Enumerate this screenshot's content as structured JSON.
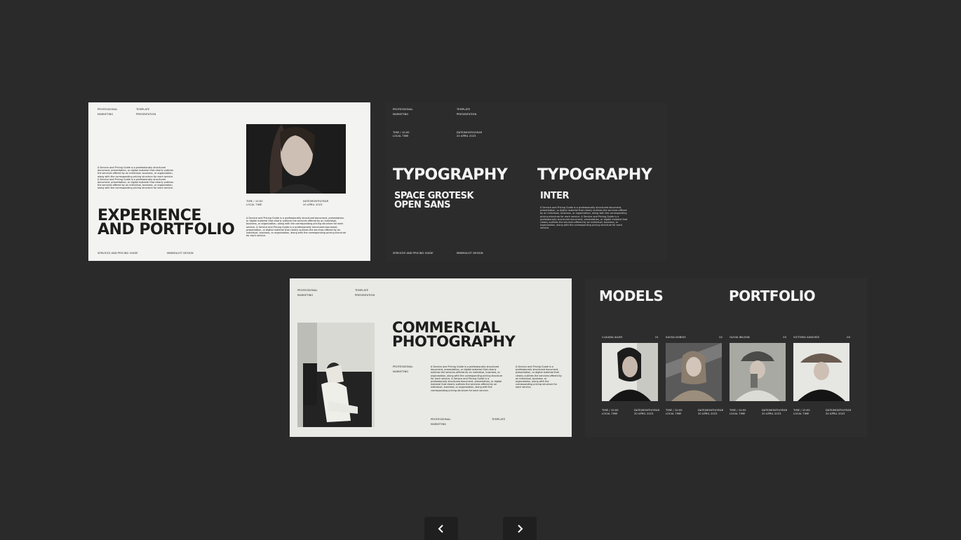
{
  "slides": {
    "s1": {
      "top_left": [
        "PROFESSIONAL",
        "MARKETING"
      ],
      "top_mid": [
        "TEMPLATE",
        "PRESENTATION"
      ],
      "paragraph": "A Service and Pricing Guide is a professionally structured document, presentation, or digital material that clearly outlines the services offered by an individual, business, or organization, along with the corresponding pricing structure for each service. A Service and Pricing Guide is a professionally structured document, presentation, or digital material that clearly outlines the services offered by an individual, business, or organization, along with the corresponding pricing structure for each service.",
      "title": "EXPERIENCE\nAND PORTFOLIO",
      "time_label": [
        "TIME / 10:00",
        "LOCAL TIME"
      ],
      "date_label": [
        "DATE/MONTH/YEAR",
        "20 APRIL 2023"
      ],
      "paragraph_right": "A Service and Pricing Guide is a professionally structured document, presentation, or digital material that clearly outlines the services offered by an individual, business, or organization, along with the corresponding pricing structure for each service. A Service and Pricing Guide is a professionally structured document, presentation, or digital material that clearly outlines the services offered by an individual, business, or organization, along with the corresponding pricing structure for each service.",
      "footer_left": "SERVICES AND PRICING GUIDE",
      "footer_mid": "MINIMALIST DESIGN"
    },
    "s2": {
      "top_left": [
        "PROFESSIONAL",
        "MARKETING"
      ],
      "top_mid": [
        "TEMPLATE",
        "PRESENTATION"
      ],
      "time_label": [
        "TIME / 10:00",
        "LOCAL TIME"
      ],
      "date_label": [
        "DATE/MONTH/YEAR",
        "20 APRIL 2023"
      ],
      "left_title": "TYPOGRAPHY",
      "left_fonts": "SPACE GROTESK\nOPEN SANS",
      "right_title": "TYPOGRAPHY",
      "right_font": "INTER",
      "paragraph": "A Service and Pricing Guide is a professionally structured document, presentation, or digital material that clearly outlines the services offered by an individual, business, or organization, along with the corresponding pricing structure for each service. A Service and Pricing Guide is a professionally structured document, presentation, or digital material that clearly outlines the services offered by an individual, business, or organization, along with the corresponding pricing structure for each service.",
      "footer_left": "SERVICES AND PRICING GUIDE",
      "footer_mid": "MINIMALIST DESIGN"
    },
    "s3": {
      "top_left": [
        "PROFESSIONAL",
        "MARKETING"
      ],
      "top_mid": [
        "TEMPLATE",
        "PRESENTATION"
      ],
      "title": "COMMERCIAL\nPHOTOGRAPHY",
      "mid_label": [
        "PROFESSIONAL",
        "MARKETING"
      ],
      "paragraph_a": "A Service and Pricing Guide is a professionally structured document, presentation, or digital material that clearly outlines the services offered by an individual, business, or organization, along with the corresponding pricing structure for each service. A Service and Pricing Guide is a professionally structured document, presentation, or digital material that clearly outlines the services offered by an individual, business, or organization, along with the corresponding pricing structure for each service.",
      "paragraph_b": "A Service and Pricing Guide is a professionally structured document, presentation, or digital material that clearly outlines the services offered by an individual, business, or organization, along with the corresponding pricing structure for each service.",
      "bottom_left": [
        "PROFESSIONAL",
        "MARKETING"
      ],
      "bottom_right": "TEMPLATE"
    },
    "s4": {
      "title_left": "MODELS",
      "title_right": "PORTFOLIO",
      "models": [
        {
          "name": "CLAUDIA ALVES",
          "num": "01",
          "time": "TIME / 10:00",
          "time2": "LOCAL TIME",
          "date": "DATE/MONTH/YEAR",
          "date2": "20 APRIL 2023"
        },
        {
          "name": "SACHA DUBOIS",
          "num": "02",
          "time": "TIME / 10:00",
          "time2": "LOCAL TIME",
          "date": "DATE/MONTH/YEAR",
          "date2": "20 APRIL 2023"
        },
        {
          "name": "OLIVIA WILSON",
          "num": "03",
          "time": "TIME / 10:00",
          "time2": "LOCAL TIME",
          "date": "DATE/MONTH/YEAR",
          "date2": "20 APRIL 2023"
        },
        {
          "name": "VICTORIA SANCHEZ",
          "num": "04",
          "time": "TIME / 10:00",
          "time2": "LOCAL TIME",
          "date": "DATE/MONTH/YEAR",
          "date2": "20 APRIL 2023"
        }
      ]
    }
  },
  "nav": {
    "prev_icon": "chevron-left-icon",
    "next_icon": "chevron-right-icon"
  }
}
